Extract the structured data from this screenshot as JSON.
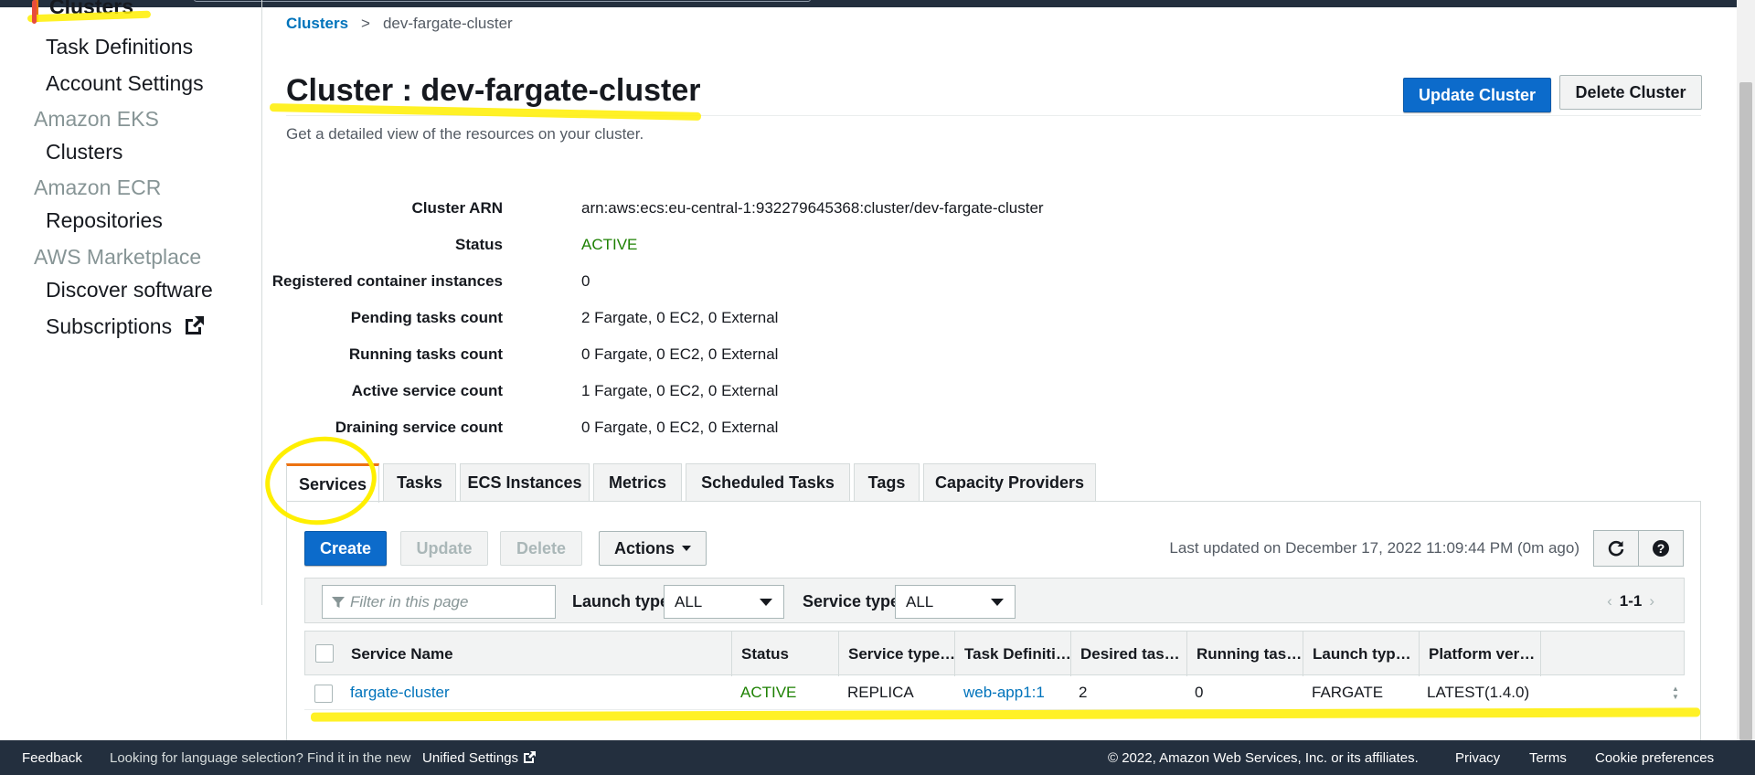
{
  "sidebar": {
    "active_item": "Clusters",
    "items": [
      {
        "type": "item",
        "label": "Task Definitions"
      },
      {
        "type": "item",
        "label": "Account Settings"
      },
      {
        "type": "header",
        "label": "Amazon EKS"
      },
      {
        "type": "item",
        "label": "Clusters"
      },
      {
        "type": "header",
        "label": "Amazon ECR"
      },
      {
        "type": "item",
        "label": "Repositories"
      },
      {
        "type": "header",
        "label": "AWS Marketplace"
      },
      {
        "type": "item",
        "label": "Discover software"
      },
      {
        "type": "item",
        "label": "Subscriptions"
      }
    ]
  },
  "breadcrumb": {
    "root": "Clusters",
    "sep": ">",
    "current": "dev-fargate-cluster"
  },
  "header": {
    "title": "Cluster : dev-fargate-cluster",
    "subtitle": "Get a detailed view of the resources on your cluster.",
    "update_label": "Update Cluster",
    "delete_label": "Delete Cluster"
  },
  "details": [
    {
      "label": "Cluster ARN",
      "value": "arn:aws:ecs:eu-central-1:932279645368:cluster/dev-fargate-cluster"
    },
    {
      "label": "Status",
      "value": "ACTIVE"
    },
    {
      "label": "Registered container instances",
      "value": "0"
    },
    {
      "label": "Pending tasks count",
      "value": "2 Fargate, 0 EC2, 0 External"
    },
    {
      "label": "Running tasks count",
      "value": "0 Fargate, 0 EC2, 0 External"
    },
    {
      "label": "Active service count",
      "value": "1 Fargate, 0 EC2, 0 External"
    },
    {
      "label": "Draining service count",
      "value": "0 Fargate, 0 EC2, 0 External"
    }
  ],
  "tabs": [
    "Services",
    "Tasks",
    "ECS Instances",
    "Metrics",
    "Scheduled Tasks",
    "Tags",
    "Capacity Providers"
  ],
  "actions": {
    "create": "Create",
    "update": "Update",
    "delete": "Delete",
    "actions": "Actions"
  },
  "last_updated": "Last updated on December 17, 2022 11:09:44 PM (0m ago)",
  "filter": {
    "placeholder": "Filter in this page",
    "launch_type_label": "Launch type",
    "launch_type_value": "ALL",
    "service_type_label": "Service type",
    "service_type_value": "ALL",
    "pagination": "1-1"
  },
  "table": {
    "columns": [
      "Service Name",
      "Status",
      "Service type…",
      "Task Definiti…",
      "Desired tas…",
      "Running tas…",
      "Launch typ…",
      "Platform ver…"
    ],
    "rows": [
      {
        "name": "fargate-cluster",
        "status": "ACTIVE",
        "service_type": "REPLICA",
        "task_def": "web-app1:1",
        "desired": "2",
        "running": "0",
        "launch": "FARGATE",
        "platform": "LATEST(1.4.0)"
      }
    ]
  },
  "footer": {
    "feedback": "Feedback",
    "lang_prompt": "Looking for language selection? Find it in the new",
    "unified": "Unified Settings",
    "copyright": "© 2022, Amazon Web Services, Inc. or its affiliates.",
    "privacy": "Privacy",
    "terms": "Terms",
    "cookies": "Cookie preferences"
  },
  "colors": {
    "primary": "#0c6bcb",
    "active_green": "#1d8102",
    "link": "#0073bb",
    "nav_dark": "#232f3e",
    "annotation": "#ffef00"
  }
}
